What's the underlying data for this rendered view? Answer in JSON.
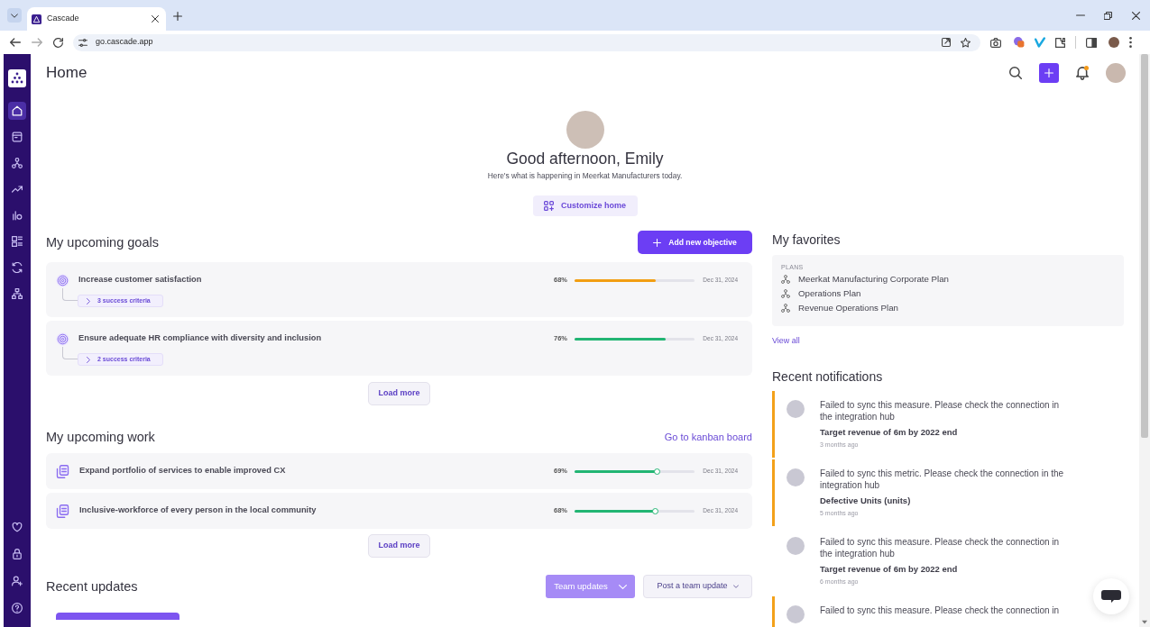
{
  "browser": {
    "tab_title": "Cascade",
    "url": "go.cascade.app"
  },
  "sidebar": {
    "top_items": [
      {
        "selected": true
      },
      {
        "selected": false
      },
      {
        "selected": false
      },
      {
        "selected": false
      },
      {
        "selected": false
      },
      {
        "selected": false
      },
      {
        "selected": false
      },
      {
        "selected": false
      }
    ],
    "bottom_items": [
      {
        "selected": false
      },
      {
        "selected": false
      },
      {
        "selected": false
      },
      {
        "selected": false
      }
    ]
  },
  "header": {
    "title": "Home",
    "has_unread_notifications": true
  },
  "greeting": {
    "title": "Good afternoon, Emily",
    "subtitle": "Here's what is happening in Meerkat Manufacturers today.",
    "button": "Customize home"
  },
  "goals": {
    "title": "My upcoming goals",
    "add_button": "Add new objective",
    "items": [
      {
        "title": "Increase customer satisfaction",
        "criteria": "3 success criteria",
        "percent": "68%",
        "level": 0.68,
        "color": "#f29e12",
        "date": "Dec 31, 2024"
      },
      {
        "title": "Ensure adequate HR compliance with diversity and inclusion",
        "criteria": "2 success criteria",
        "percent": "76%",
        "level": 0.76,
        "color": "#22b573",
        "date": "Dec 31, 2024"
      }
    ],
    "load_more": "Load more"
  },
  "work": {
    "title": "My upcoming work",
    "link": "Go to kanban board",
    "items": [
      {
        "title": "Expand portfolio of services to enable improved CX",
        "percent": "69%",
        "level": 0.69,
        "date": "Dec 31, 2024"
      },
      {
        "title": "Inclusive-workforce of every person in the local community",
        "percent": "68%",
        "level": 0.68,
        "date": "Dec 31, 2024"
      }
    ],
    "load_more": "Load more"
  },
  "updates": {
    "title": "Recent updates",
    "filter_button": "Team updates",
    "post_button": "Post a team update"
  },
  "favorites": {
    "title": "My favorites",
    "group_label": "PLANS",
    "items": [
      "Meerkat Manufacturing Corporate Plan",
      "Operations Plan",
      "Revenue Operations Plan"
    ],
    "view_all": "View all"
  },
  "notifications": {
    "title": "Recent notifications",
    "items": [
      {
        "unread": true,
        "message": "Failed to sync this measure. Please check the connection in the integration hub",
        "subject": "Target revenue of 6m by 2022 end",
        "time": "3 months ago"
      },
      {
        "unread": true,
        "message": "Failed to sync this metric. Please check the connection in the integration hub",
        "subject": "Defective Units (units)",
        "time": "5 months ago"
      },
      {
        "unread": false,
        "message": "Failed to sync this measure. Please check the connection in the integration hub",
        "subject": "Target revenue of 6m by 2022 end",
        "time": "6 months ago"
      },
      {
        "unread": true,
        "message": "Failed to sync this measure. Please check the connection in"
      }
    ]
  }
}
